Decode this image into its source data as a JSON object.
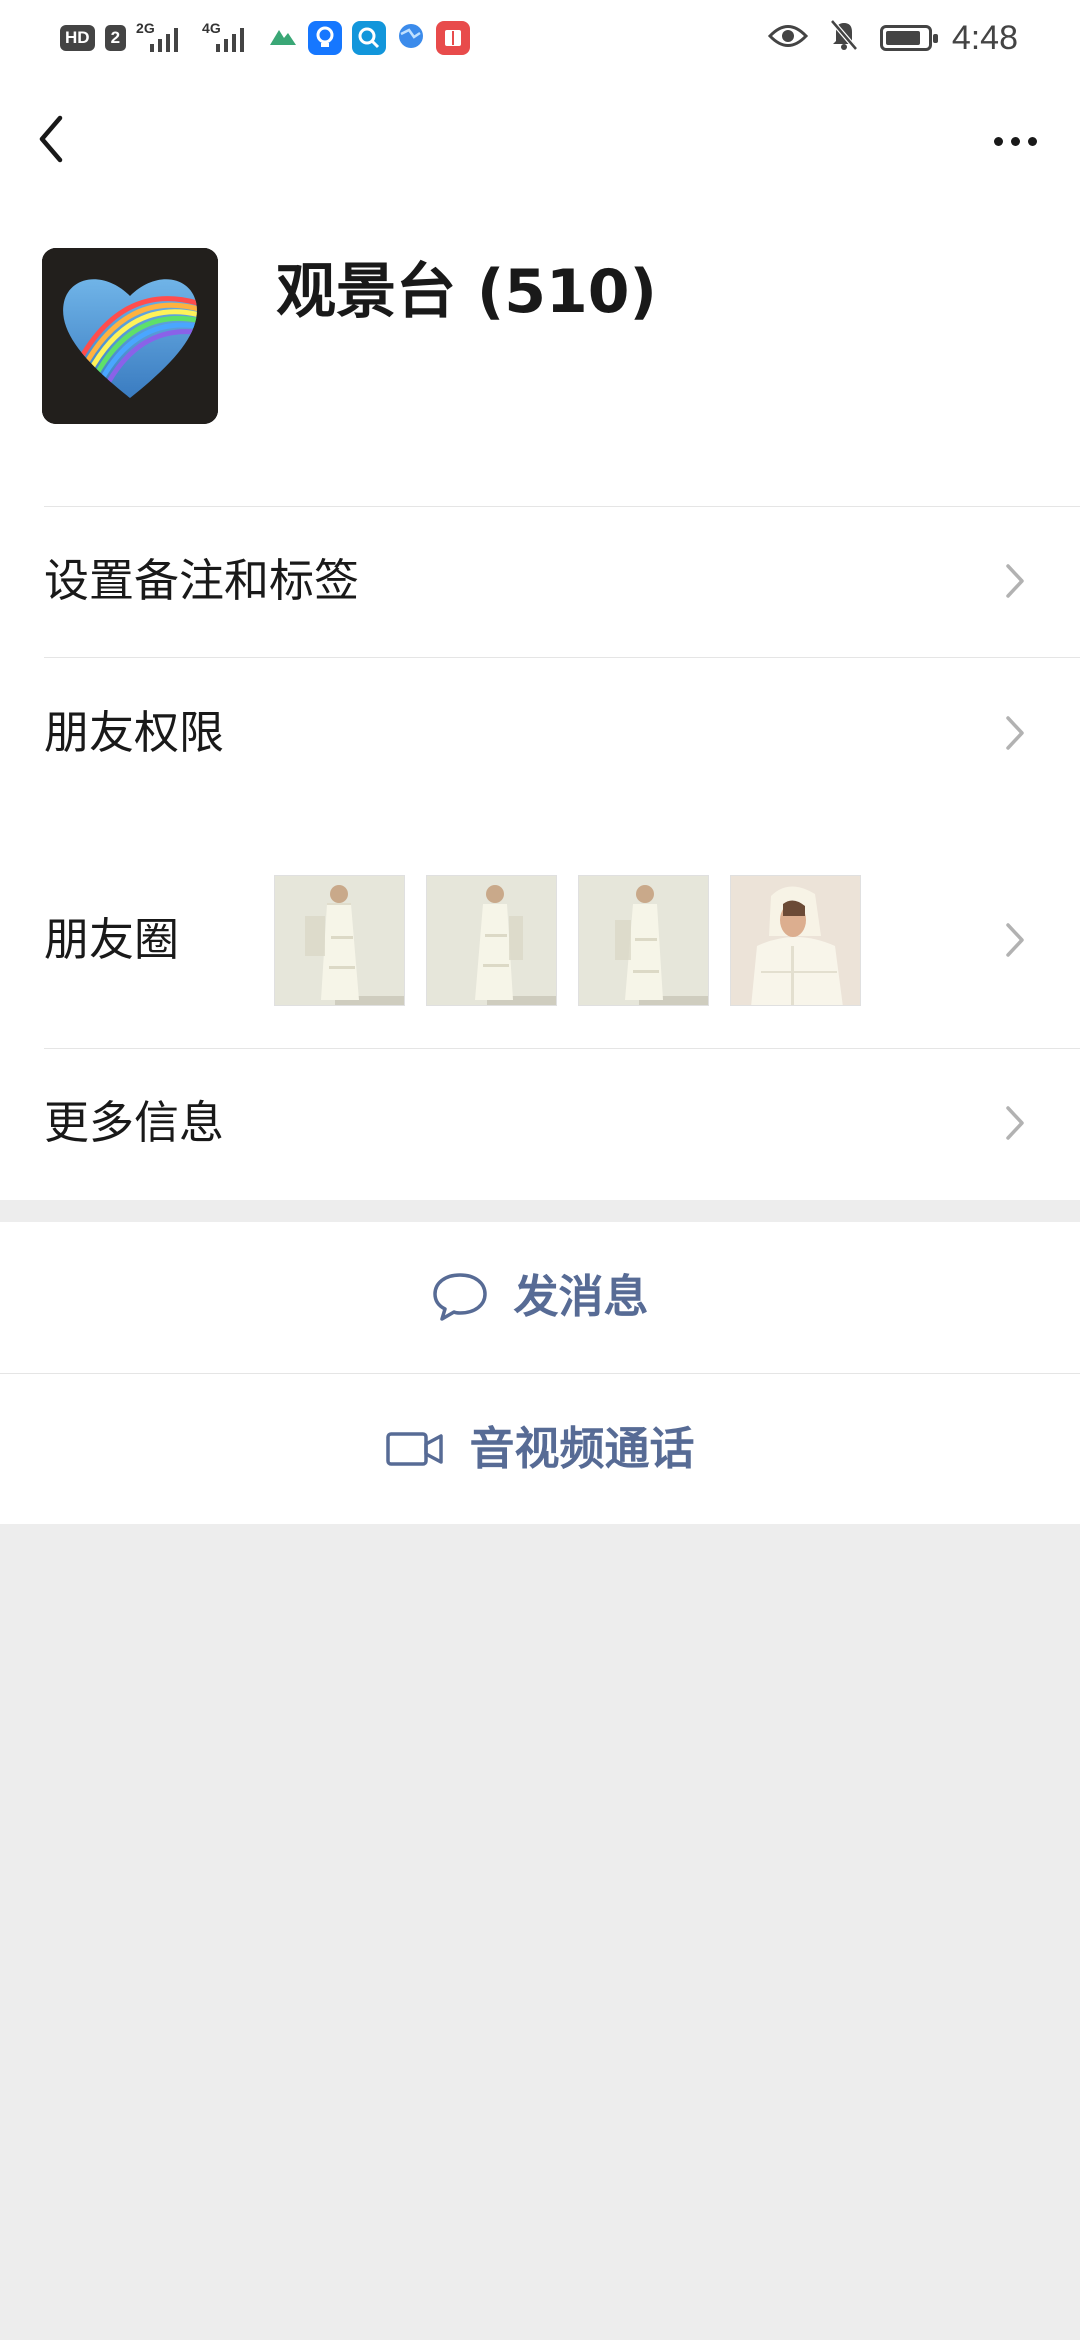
{
  "status_bar": {
    "hd": "HD",
    "sim": "2",
    "net1": "2G",
    "net2": "4G",
    "time": "4:48",
    "icons": [
      "eye-icon",
      "bell-off-icon",
      "battery-icon"
    ],
    "apps": [
      {
        "name": "mountain-app-icon",
        "color": "#3aa776"
      },
      {
        "name": "bulb-app-icon",
        "color": "#1677ff"
      },
      {
        "name": "search-app-icon",
        "color": "#1296db"
      },
      {
        "name": "globe-app-icon",
        "color": "#3b8beb"
      },
      {
        "name": "book-app-icon",
        "color": "#e84b4b"
      }
    ]
  },
  "nav": {
    "back_icon": "chevron-left-icon",
    "more_icon": "more-dots-icon"
  },
  "profile": {
    "name": "观景台 (510)",
    "avatar": "rainbow-heart-avatar"
  },
  "menu": {
    "remark_label": "设置备注和标签",
    "permission_label": "朋友权限",
    "moments_label": "朋友圈",
    "more_info_label": "更多信息",
    "moments_thumbnails": [
      "white-down-coat-photo",
      "white-down-coat-photo",
      "white-down-coat-photo",
      "hooded-coat-photo"
    ]
  },
  "actions": {
    "message_label": "发消息",
    "message_icon": "chat-bubble-icon",
    "video_call_label": "音视频通话",
    "video_call_icon": "video-camera-icon"
  },
  "colors": {
    "link": "#576b95",
    "background": "#ededed",
    "surface": "#ffffff"
  }
}
